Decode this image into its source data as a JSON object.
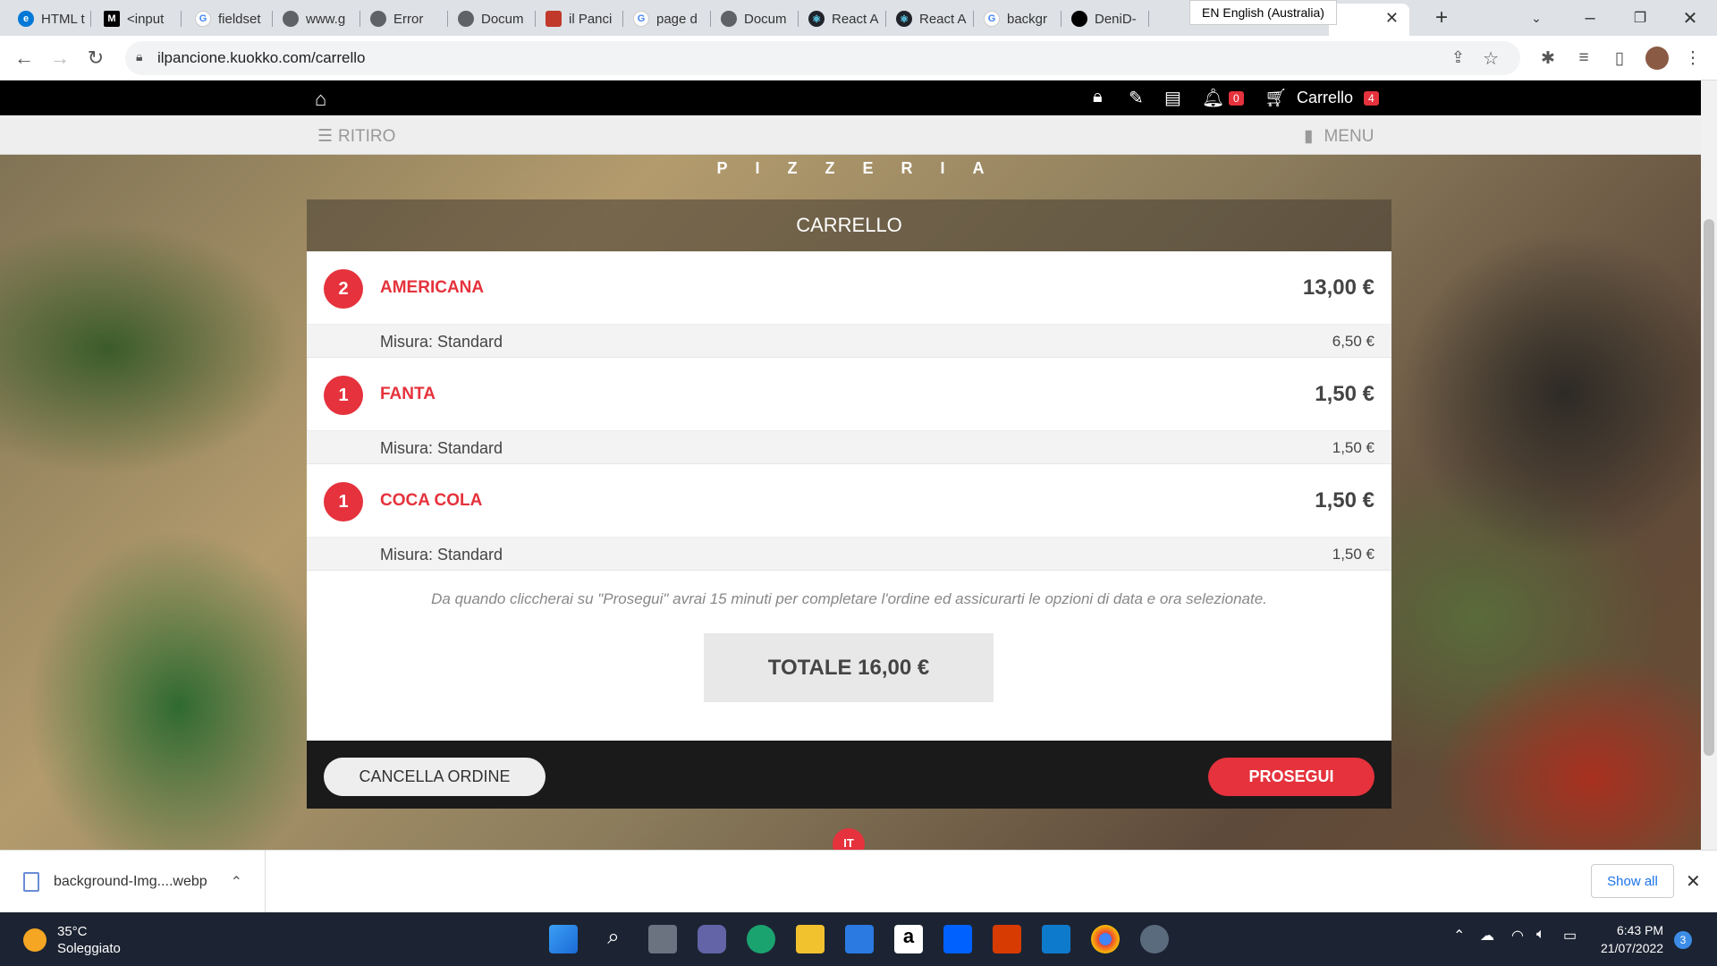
{
  "browser": {
    "tabs": [
      {
        "label": "HTML t",
        "icon": "edge-icon",
        "color": "#0078d7"
      },
      {
        "label": "<input",
        "icon": "mdn-icon",
        "color": "#000000"
      },
      {
        "label": "fieldset",
        "icon": "google-icon",
        "color": "#4285f4"
      },
      {
        "label": "www.g",
        "icon": "globe-icon",
        "color": "#5f6368"
      },
      {
        "label": "Error",
        "icon": "globe-icon",
        "color": "#5f6368"
      },
      {
        "label": "Docum",
        "icon": "globe-icon",
        "color": "#5f6368"
      },
      {
        "label": "il Panci",
        "icon": "pancione-icon",
        "color": "#c0392b"
      },
      {
        "label": "page d",
        "icon": "google-icon",
        "color": "#4285f4"
      },
      {
        "label": "Docum",
        "icon": "globe-icon",
        "color": "#5f6368"
      },
      {
        "label": "React A",
        "icon": "react-icon",
        "color": "#20232a"
      },
      {
        "label": "React A",
        "icon": "react-icon",
        "color": "#20232a"
      },
      {
        "label": "backgr",
        "icon": "google-icon",
        "color": "#4285f4"
      },
      {
        "label": "DeniD-",
        "icon": "github-icon",
        "color": "#000000"
      }
    ],
    "ime_label": "EN English (Australia)",
    "url": "ilpancione.kuokko.com/carrello"
  },
  "site": {
    "nav": {
      "notifications_count": "0",
      "cart_label": "Carrello",
      "cart_count": "4"
    },
    "subnav": {
      "left_label": "RITIRO",
      "right_label": "MENU"
    },
    "brand_text": "PIZZERIA",
    "cart": {
      "title": "CARRELLO",
      "items": [
        {
          "qty": "2",
          "name": "AMERICANA",
          "price": "13,00 €",
          "option": "Misura: Standard",
          "option_price": "6,50 €"
        },
        {
          "qty": "1",
          "name": "FANTA",
          "price": "1,50 €",
          "option": "Misura: Standard",
          "option_price": "1,50 €"
        },
        {
          "qty": "1",
          "name": "COCA COLA",
          "price": "1,50 €",
          "option": "Misura: Standard",
          "option_price": "1,50 €"
        }
      ],
      "note": "Da quando cliccherai su \"Prosegui\" avrai 15 minuti per completare l'ordine ed assicurarti le opzioni di data e ora selezionate.",
      "total": "TOTALE 16,00 €",
      "cancel_label": "CANCELLA ORDINE",
      "next_label": "PROSEGUI"
    },
    "lang": "IT",
    "accent_color": "#e5323c"
  },
  "downloads": {
    "file_name": "background-Img....webp",
    "show_all": "Show all"
  },
  "taskbar": {
    "temperature": "35°C",
    "weather": "Soleggiato",
    "time": "6:43 PM",
    "date": "21/07/2022",
    "notifications": "3"
  }
}
